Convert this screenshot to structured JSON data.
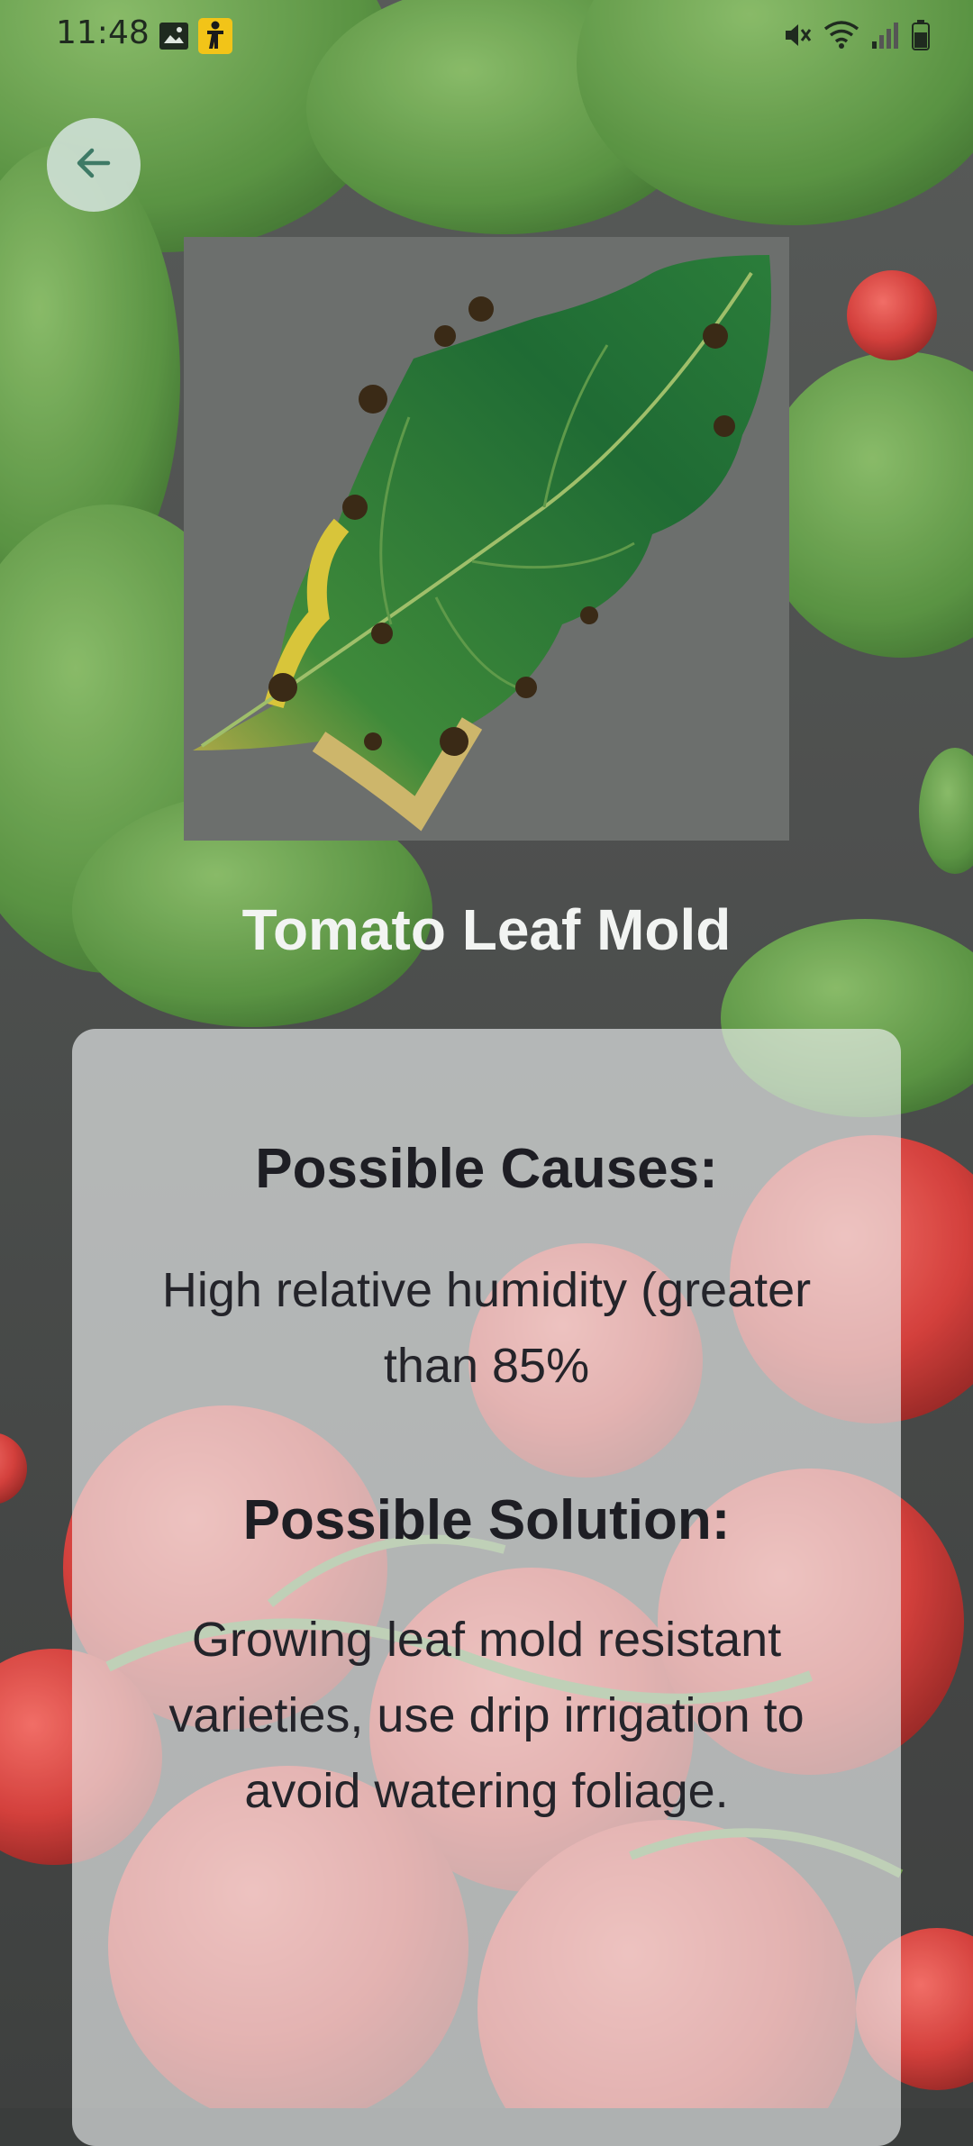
{
  "status_bar": {
    "time": "11:48",
    "left_icons": [
      "gallery-icon",
      "accessibility-icon"
    ],
    "right_icons": [
      "mute-icon",
      "wifi-icon",
      "signal-icon",
      "battery-icon"
    ]
  },
  "navigation": {
    "back_icon": "arrow-left-icon"
  },
  "disease": {
    "title": "Tomato Leaf Mold",
    "image_icon": "leaf-photo"
  },
  "card": {
    "causes_heading": "Possible Causes:",
    "causes_text": "High relative humidity (greater than 85%",
    "solution_heading": "Possible Solution:",
    "solution_text": "Growing leaf mold resistant varieties, use drip irrigation to avoid watering foliage."
  },
  "colors": {
    "back_button_bg": "#d2e1da",
    "back_arrow": "#3e7a66",
    "title_text": "#f2f4f2",
    "card_text": "#1e1e24"
  }
}
